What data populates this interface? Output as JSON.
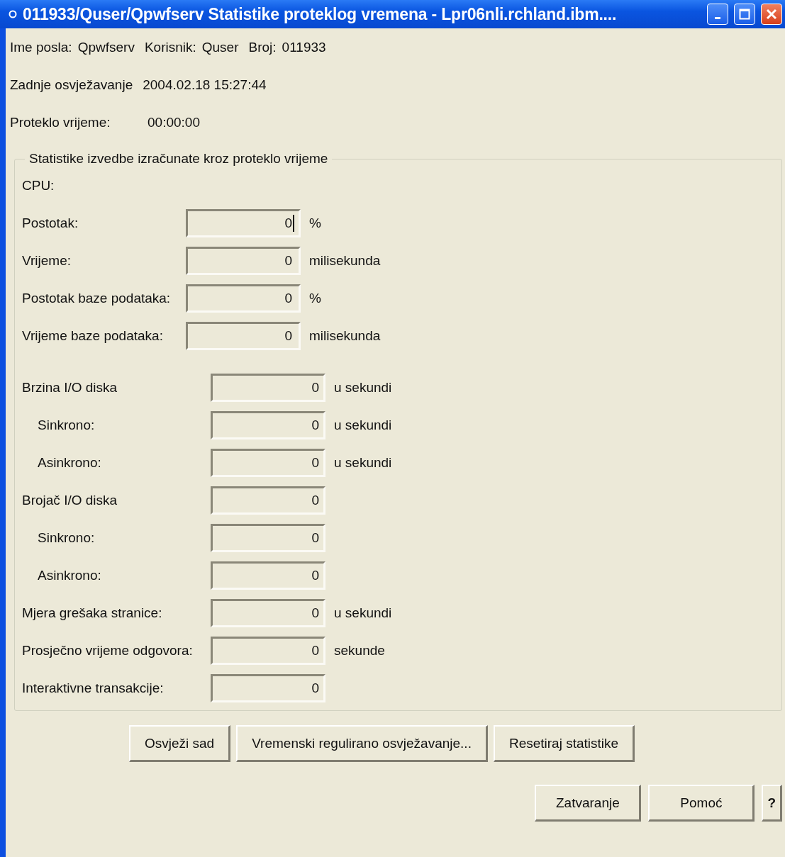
{
  "window": {
    "title": "011933/Quser/Qpwfserv Statistike proteklog vremena - Lpr06nli.rchland.ibm....",
    "controls": [
      {
        "kind": "minimize"
      },
      {
        "kind": "maximize"
      },
      {
        "kind": "close"
      }
    ]
  },
  "info": {
    "job": [
      {
        "label": "Ime posla:",
        "value": "Qpwfserv"
      },
      {
        "label": "Korisnik:",
        "value": "Quser"
      },
      {
        "label": "Broj:",
        "value": "011933"
      }
    ],
    "last_refresh": {
      "label": "Zadnje osvježavanje",
      "value": "2004.02.18 15:27:44"
    },
    "elapsed": {
      "label": "Proteklo vrijeme:",
      "value": "00:00:00"
    }
  },
  "group": {
    "title": "Statistike izvedbe izračunate kroz proteklo vrijeme",
    "cpu": {
      "label": "CPU:",
      "rows": [
        {
          "label": "Postotak:",
          "value": "0",
          "unit": "%",
          "focused": true
        },
        {
          "label": "Vrijeme:",
          "value": "0",
          "unit": "milisekunda",
          "focused": false
        },
        {
          "label": "Postotak baze podataka:",
          "value": "0",
          "unit": "%",
          "focused": false
        },
        {
          "label": "Vrijeme baze podataka:",
          "value": "0",
          "unit": "milisekunda",
          "focused": false
        }
      ]
    },
    "rows": [
      {
        "label": "Brzina I/O diska",
        "value": "0",
        "unit": "u sekundi",
        "children": [
          {
            "label": "Sinkrono:",
            "value": "0",
            "unit": "u sekundi"
          },
          {
            "label": "Asinkrono:",
            "value": "0",
            "unit": "u sekundi"
          }
        ]
      },
      {
        "label": "Brojač I/O diska",
        "value": "0",
        "children": [
          {
            "label": "Sinkrono:",
            "value": "0"
          },
          {
            "label": "Asinkrono:",
            "value": "0"
          }
        ]
      },
      {
        "label": "Mjera grešaka stranice:",
        "value": "0",
        "unit": "u sekundi"
      },
      {
        "label": "Prosječno vrijeme odgovora:",
        "value": "0",
        "unit": "sekunde"
      },
      {
        "label": "Interaktivne transakcije:",
        "value": "0"
      }
    ]
  },
  "actions": [
    "Osvježi sad",
    "Vremenski regulirano osvježavanje...",
    "Resetiraj statistike"
  ],
  "footer_buttons": [
    "Zatvaranje",
    "Pomoć",
    "?"
  ]
}
